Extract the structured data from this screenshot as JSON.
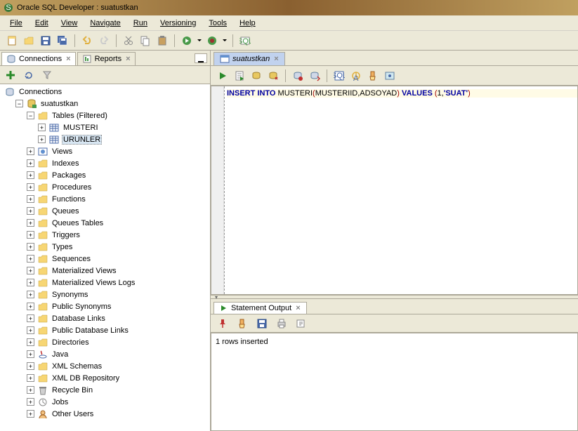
{
  "window": {
    "title": "Oracle SQL Developer : suatustkan"
  },
  "menu": {
    "items": [
      "File",
      "Edit",
      "View",
      "Navigate",
      "Run",
      "Versioning",
      "Tools",
      "Help"
    ]
  },
  "left": {
    "tabs": {
      "connections": "Connections",
      "reports": "Reports"
    },
    "root": "Connections",
    "conn": "suatustkan",
    "tables": "Tables (Filtered)",
    "table_items": [
      "MUSTERI",
      "URUNLER"
    ],
    "nodes": [
      "Views",
      "Indexes",
      "Packages",
      "Procedures",
      "Functions",
      "Queues",
      "Queues Tables",
      "Triggers",
      "Types",
      "Sequences",
      "Materialized Views",
      "Materialized Views Logs",
      "Synonyms",
      "Public Synonyms",
      "Database Links",
      "Public Database Links",
      "Directories",
      "Java",
      "XML Schemas",
      "XML DB Repository",
      "Recycle Bin",
      "Jobs",
      "Other Users"
    ]
  },
  "editor": {
    "tab": "suatustkan",
    "sql": {
      "kw1": "INSERT",
      "kw2": "INTO",
      "tbl": "MUSTERI",
      "cols": "MUSTERIID,ADSOYAD",
      "kw3": "VALUES",
      "val1": "1",
      "val2": "'SUAT'"
    }
  },
  "output": {
    "tab": "Statement Output",
    "text": "1 rows inserted"
  }
}
